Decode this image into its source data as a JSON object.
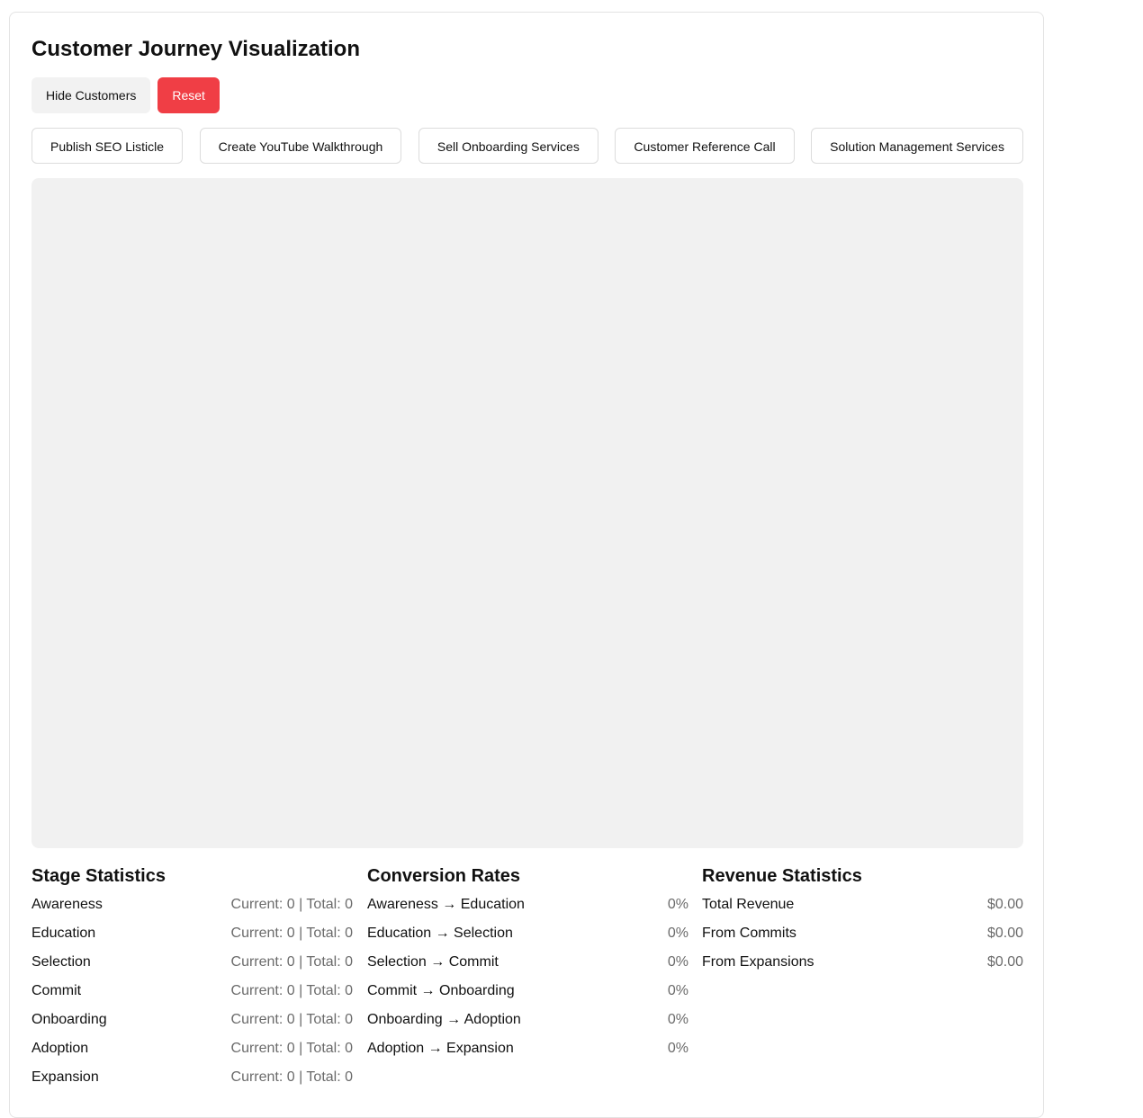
{
  "title": "Customer Journey Visualization",
  "controls": {
    "hide_label": "Hide Customers",
    "reset_label": "Reset"
  },
  "actions": [
    {
      "label": "Publish SEO Listicle"
    },
    {
      "label": "Create YouTube Walkthrough"
    },
    {
      "label": "Sell Onboarding Services"
    },
    {
      "label": "Customer Reference Call"
    },
    {
      "label": "Solution Management Services"
    }
  ],
  "stage_stats": {
    "title": "Stage Statistics",
    "rows": [
      {
        "label": "Awareness",
        "value": "Current: 0 | Total: 0"
      },
      {
        "label": "Education",
        "value": "Current: 0 | Total: 0"
      },
      {
        "label": "Selection",
        "value": "Current: 0 | Total: 0"
      },
      {
        "label": "Commit",
        "value": "Current: 0 | Total: 0"
      },
      {
        "label": "Onboarding",
        "value": "Current: 0 | Total: 0"
      },
      {
        "label": "Adoption",
        "value": "Current: 0 | Total: 0"
      },
      {
        "label": "Expansion",
        "value": "Current: 0 | Total: 0"
      }
    ]
  },
  "conversion_rates": {
    "title": "Conversion Rates",
    "rows": [
      {
        "label": "Awareness → Education",
        "value": "0%"
      },
      {
        "label": "Education → Selection",
        "value": "0%"
      },
      {
        "label": "Selection → Commit",
        "value": "0%"
      },
      {
        "label": "Commit → Onboarding",
        "value": "0%"
      },
      {
        "label": "Onboarding → Adoption",
        "value": "0%"
      },
      {
        "label": "Adoption → Expansion",
        "value": "0%"
      }
    ]
  },
  "revenue_stats": {
    "title": "Revenue Statistics",
    "rows": [
      {
        "label": "Total Revenue",
        "value": "$0.00"
      },
      {
        "label": "From Commits",
        "value": "$0.00"
      },
      {
        "label": "From Expansions",
        "value": "$0.00"
      }
    ]
  },
  "colors": {
    "reset_bg": "#f03e45",
    "canvas_bg": "#f1f1f1",
    "muted_text": "#6b6b6b"
  }
}
